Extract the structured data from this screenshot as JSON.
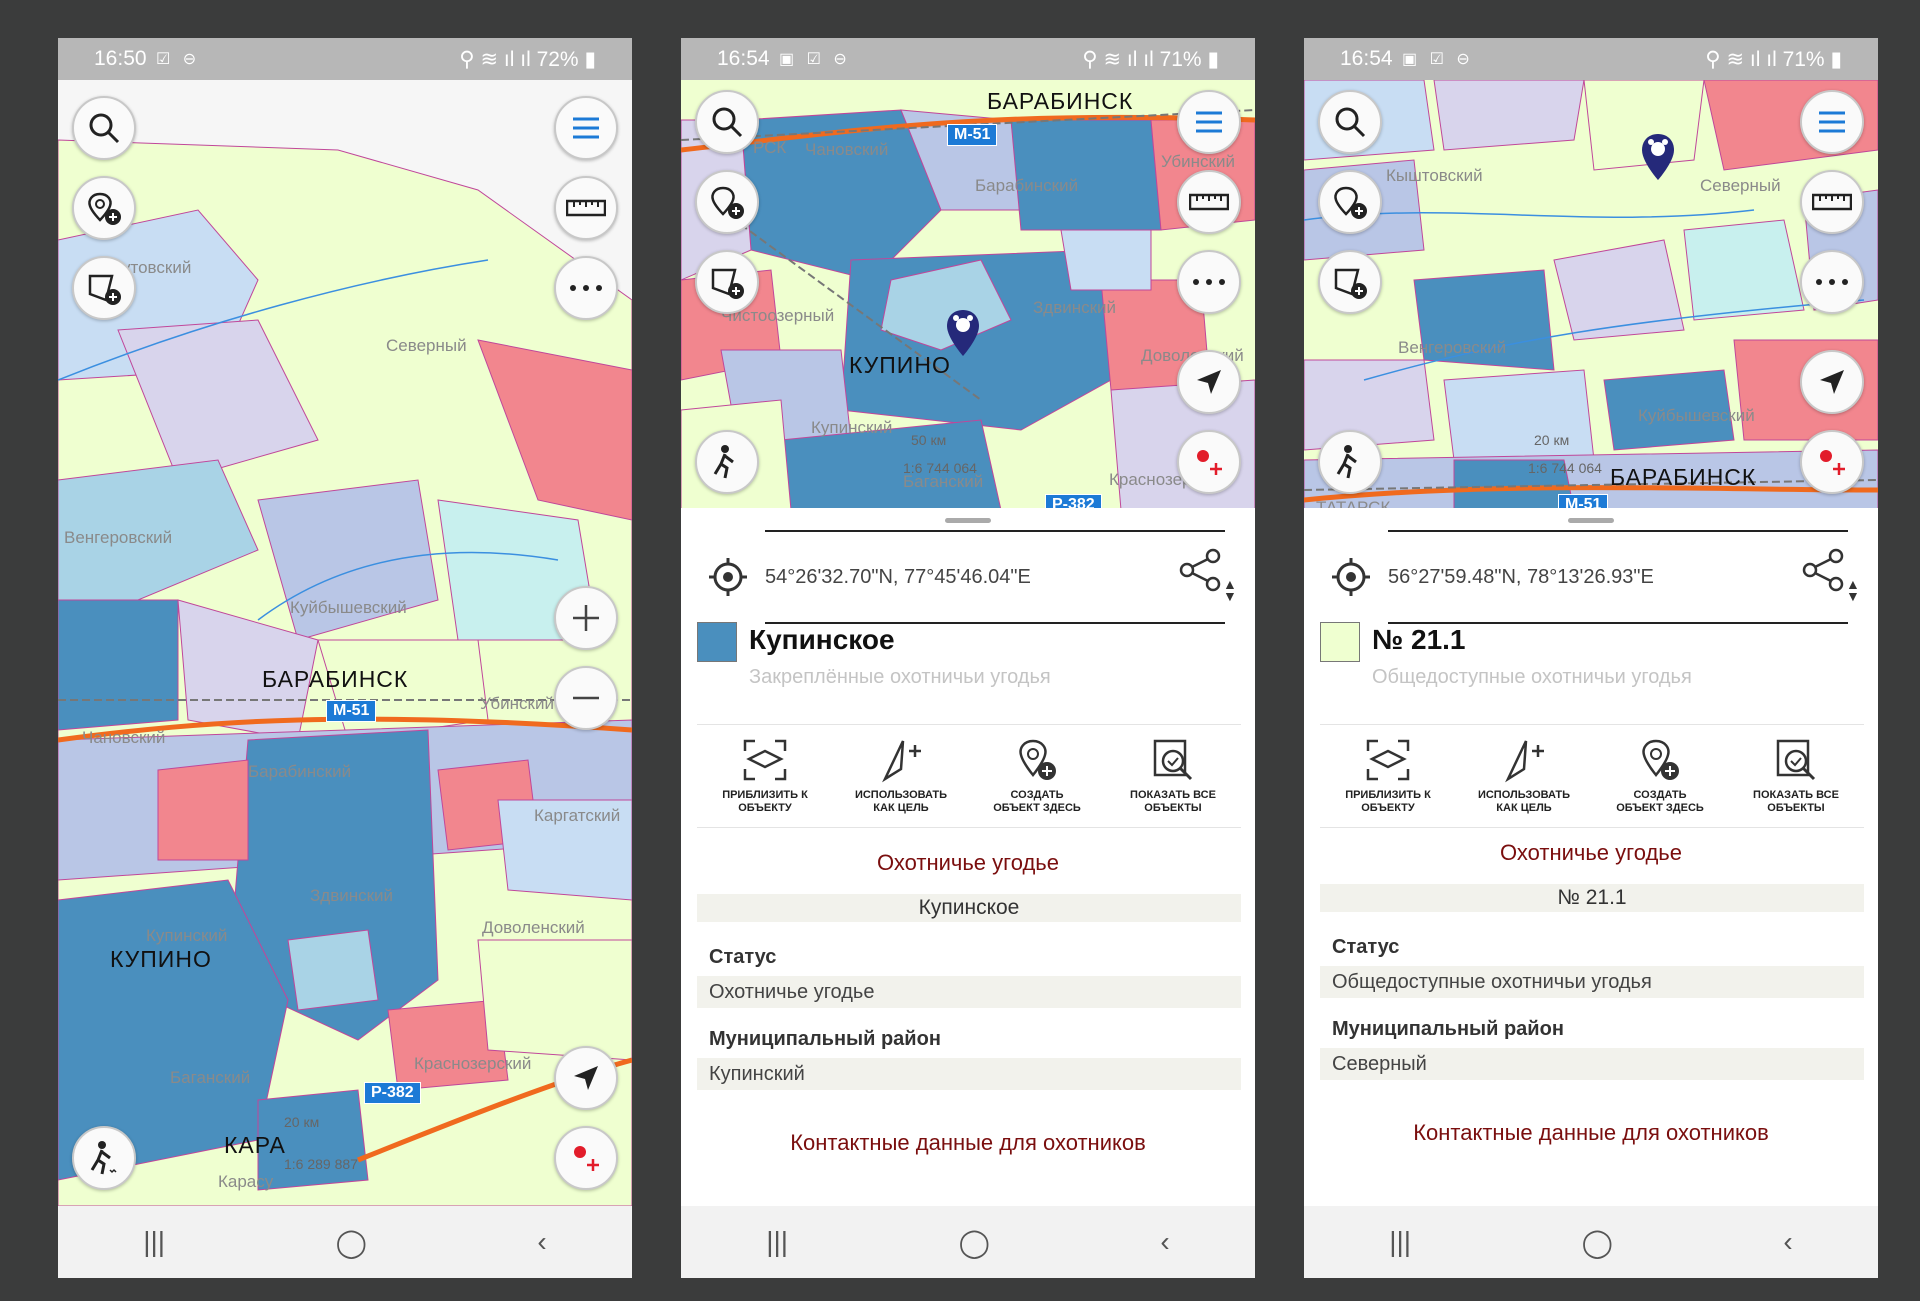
{
  "colors": {
    "accent": "#1c7ad6",
    "dark_red": "#7a0e0e",
    "fixed_land": "#4a8fbe",
    "public_land": "#efffd0",
    "marker": "#25297a"
  },
  "phones": [
    {
      "time": "16:50",
      "battery": "72%",
      "map_labels": [
        "Венгеровский",
        "Северный",
        "Куйбышевский",
        "Чановский",
        "Барабинский",
        "Убинский",
        "Каргатский",
        "Здвинский",
        "Купинский",
        "Доволенский",
        "Баганский",
        "Краснозерский"
      ],
      "partial_label": "утовский",
      "cities": [
        "БАРАБИНСК",
        "КУПИНО",
        "КАРА"
      ],
      "roads": [
        "М-51",
        "Р-382"
      ],
      "scale_km": "20 км",
      "scale_ratio": "1:6 289 887",
      "partial_bottom": "Карасу"
    },
    {
      "time": "16:54",
      "battery": "71%",
      "map_labels": [
        "Чановский",
        "Барабинский",
        "Убинский",
        "Чистоозерный",
        "Здвинский",
        "Доволенский",
        "Купинский",
        "Баганский",
        "Краснозерский"
      ],
      "partial_label": "РСК",
      "cities": [
        "БАРАБИНСК",
        "КУПИНО"
      ],
      "roads": [
        "М-51",
        "Р-382"
      ],
      "scale_km": "50 км",
      "scale_ratio": "1:6 744 064",
      "coords": "54°26'32.70\"N, 77°45'46.04\"E",
      "title": "Купинское",
      "subtitle": "Закреплённые охотничьи угодья",
      "section": "Охотничье угодье",
      "name": "Купинское",
      "status_label": "Статус",
      "status_value": "Охотничье угодье",
      "district_label": "Муниципальный район",
      "district_value": "Купинский",
      "contacts": "Контактные данные для охотников"
    },
    {
      "time": "16:54",
      "battery": "71%",
      "map_labels": [
        "Кыштовский",
        "Северный",
        "Венгеровский",
        "Куйбышевский"
      ],
      "partial_label": "ТАТАРСК",
      "cities": [
        "БАРАБИНСК"
      ],
      "roads": [
        "М-51"
      ],
      "scale_km": "20 км",
      "scale_ratio": "1:6 744 064",
      "coords": "56°27'59.48\"N, 78°13'26.93\"E",
      "title": "№ 21.1",
      "subtitle": "Общедоступные охотничьи угодья",
      "section": "Охотничье угодье",
      "name": "№ 21.1",
      "status_label": "Статус",
      "status_value": "Общедоступные охотничьи угодья",
      "district_label": "Муниципальный район",
      "district_value": "Северный",
      "contacts": "Контактные данные для охотников"
    }
  ],
  "actions": [
    {
      "l1": "ПРИБЛИЗИТЬ К",
      "l2": "ОБЪЕКТУ"
    },
    {
      "l1": "ИСПОЛЬЗОВАТЬ",
      "l2": "КАК ЦЕЛЬ"
    },
    {
      "l1": "СОЗДАТЬ",
      "l2": "ОБЪЕКТ ЗДЕСЬ"
    },
    {
      "l1": "ПОКАЗАТЬ ВСЕ",
      "l2": "ОБЪЕКТЫ"
    }
  ],
  "nav": {
    "recent": "|||",
    "home": "◯",
    "back": "‹"
  }
}
